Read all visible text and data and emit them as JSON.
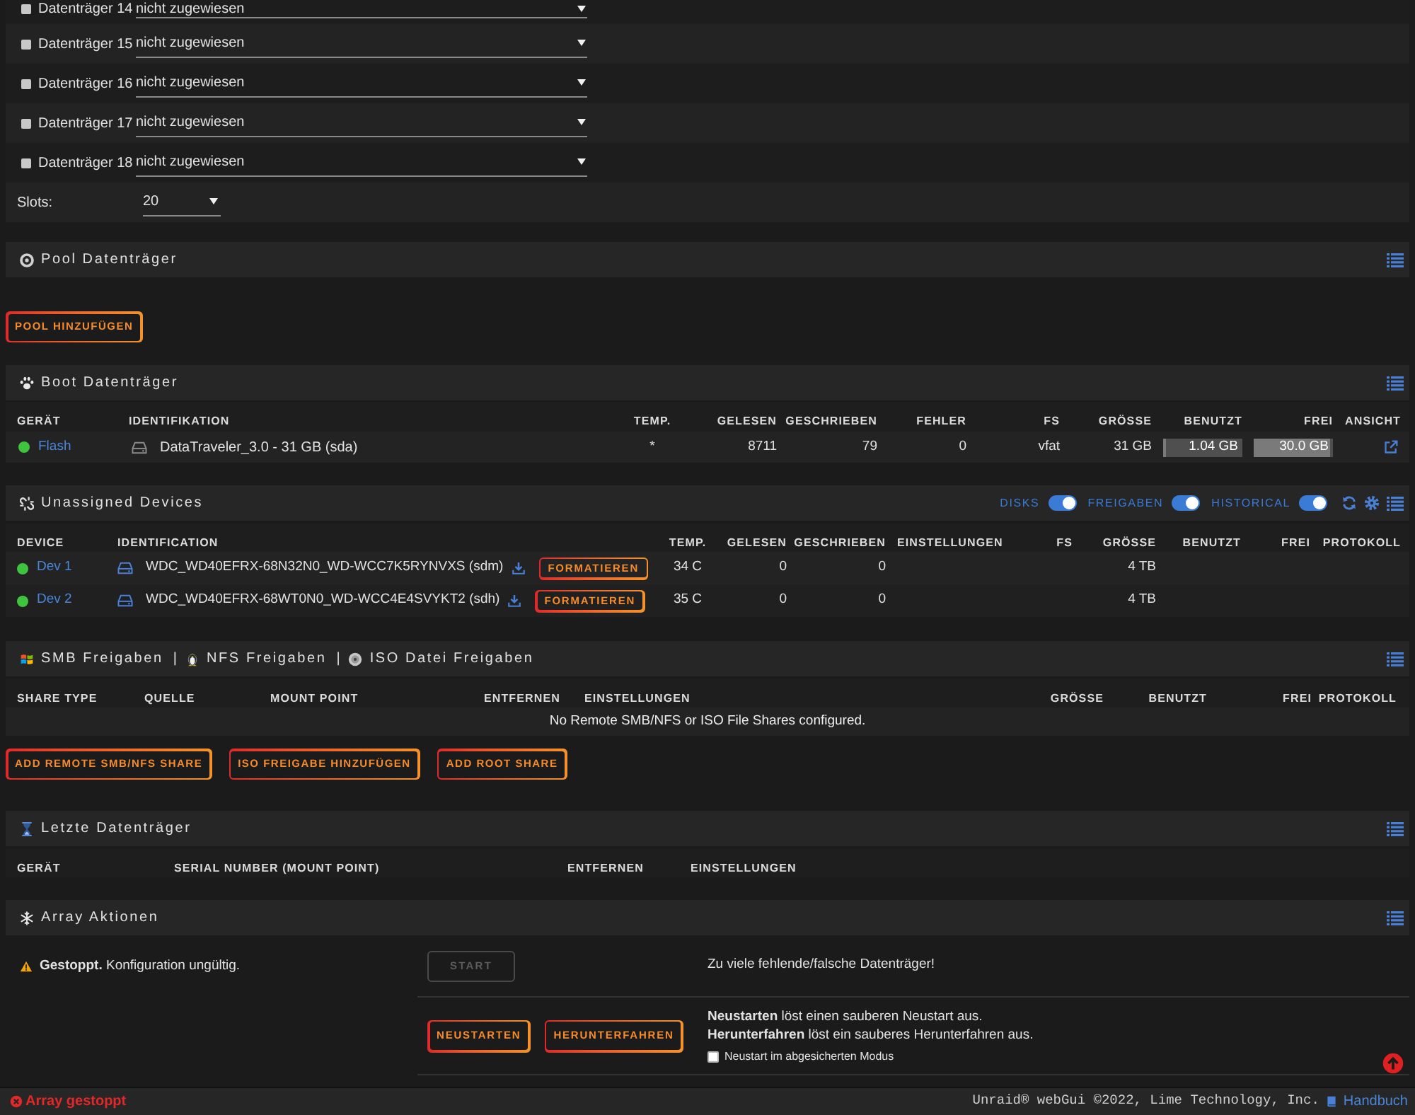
{
  "disk_slots": [
    {
      "label": "Datenträger 14",
      "value": "nicht zugewiesen"
    },
    {
      "label": "Datenträger 15",
      "value": "nicht zugewiesen"
    },
    {
      "label": "Datenträger 16",
      "value": "nicht zugewiesen"
    },
    {
      "label": "Datenträger 17",
      "value": "nicht zugewiesen"
    },
    {
      "label": "Datenträger 18",
      "value": "nicht zugewiesen"
    }
  ],
  "slots": {
    "label": "Slots:",
    "value": "20"
  },
  "pool": {
    "title": "Pool Datenträger",
    "buttons": [
      "POOL HINZUFÜGEN"
    ]
  },
  "boot": {
    "title": "Boot Datenträger",
    "columns": [
      "GERÄT",
      "IDENTIFIKATION",
      "TEMP.",
      "GELESEN",
      "GESCHRIEBEN",
      "FEHLER",
      "FS",
      "GRÖSSE",
      "BENUTZT",
      "FREI",
      "ANSICHT"
    ],
    "rows": [
      {
        "online": true,
        "device": "Flash",
        "identification": "DataTraveler_3.0 - 31 GB (sda)",
        "temp": "*",
        "reads": "8711",
        "writes": "79",
        "errors": "0",
        "fs": "vfat",
        "size": "31 GB",
        "used": {
          "text": "1.04 GB",
          "level": 0.03
        },
        "free": {
          "text": "30.0 GB",
          "level": 0.97
        }
      }
    ]
  },
  "unassigned": {
    "title": "Unassigned Devices",
    "toggles": [
      {
        "label": "DISKS",
        "on": true
      },
      {
        "label": "FREIGABEN",
        "on": true
      },
      {
        "label": "HISTORICAL",
        "on": true
      }
    ],
    "columns": [
      "DEVICE",
      "IDENTIFICATION",
      "TEMP.",
      "GELESEN",
      "GESCHRIEBEN",
      "EINSTELLUNGEN",
      "FS",
      "GRÖSSE",
      "BENUTZT",
      "FREI",
      "PROTOKOLL"
    ],
    "rows": [
      {
        "online": true,
        "device": "Dev 1",
        "identification": "WDC_WD40EFRX-68N32N0_WD-WCC7K5RYNVXS (sdm)",
        "action": "FORMATIEREN",
        "temp": "34 C",
        "reads": "0",
        "writes": "0",
        "size": "4 TB"
      },
      {
        "online": true,
        "device": "Dev 2",
        "identification": "WDC_WD40EFRX-68WT0N0_WD-WCC4E4SVYKT2 (sdh)",
        "action": "FORMATIEREN",
        "temp": "35 C",
        "reads": "0",
        "writes": "0",
        "size": "4 TB"
      }
    ]
  },
  "shares": {
    "title_parts": [
      {
        "kind": "smb",
        "label": "SMB Freigaben"
      },
      {
        "kind": "nfs",
        "separator": "|",
        "label": "NFS Freigaben"
      },
      {
        "kind": "iso",
        "separator": "|",
        "label": "ISO Datei Freigaben"
      }
    ],
    "columns": [
      "SHARE TYPE",
      "QUELLE",
      "MOUNT POINT",
      "ENTFERNEN",
      "EINSTELLUNGEN",
      "GRÖSSE",
      "BENUTZT",
      "FREI",
      "PROTOKOLL"
    ],
    "empty_message": "No Remote SMB/NFS or ISO File Shares configured.",
    "buttons": [
      "ADD REMOTE SMB/NFS SHARE",
      "ISO FREIGABE HINZUFÜGEN",
      "ADD ROOT SHARE"
    ]
  },
  "recent": {
    "title": "Letzte Datenträger",
    "columns": [
      "GERÄT",
      "SERIAL NUMBER (MOUNT POINT)",
      "ENTFERNEN",
      "EINSTELLUNGEN"
    ]
  },
  "array_actions": {
    "title": "Array Aktionen",
    "status": "**Gestoppt.** Konfiguration ungültig.",
    "start_button": {
      "label": "START",
      "disabled": true
    },
    "start_message": "Zu viele fehlende/falsche Datenträger!",
    "buttons": [
      "NEUSTARTEN",
      "HERUNTERFAHREN"
    ],
    "notes": [
      "**Neustarten** löst einen sauberen Neustart aus.",
      "**Herunterfahren** löst ein sauberes Herunterfahren aus."
    ],
    "safe_mode": {
      "label": "Neustart im abgesicherten Modus",
      "checked": false
    }
  },
  "status_bar": {
    "array_status": "Array gestoppt",
    "copyright": "Unraid® webGui ©2022, Lime Technology, Inc.",
    "manual_link": "Handbuch"
  }
}
